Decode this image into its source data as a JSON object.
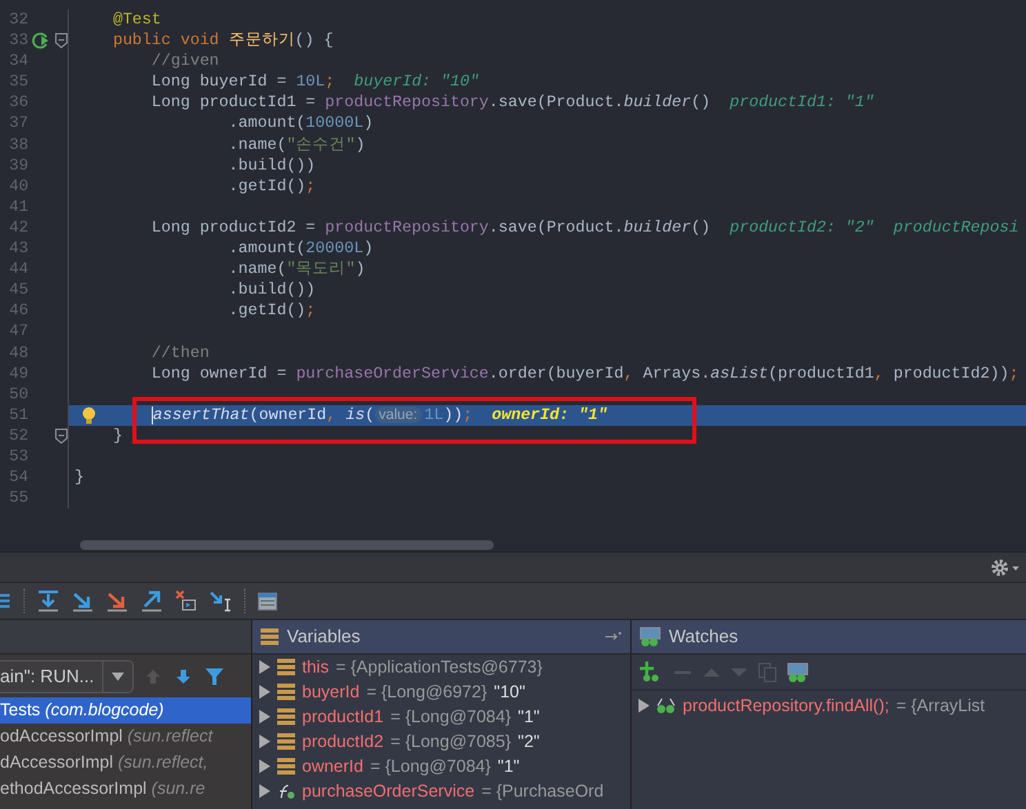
{
  "editor": {
    "lines": [
      {
        "number": "32",
        "current": false,
        "boxed": false,
        "segments": [
          {
            "kind": "annotation",
            "text": "    @Test"
          }
        ]
      },
      {
        "number": "33",
        "current": false,
        "boxed": false,
        "markers": [
          {
            "kind": "run"
          },
          {
            "kind": "fold"
          }
        ],
        "segments": [
          {
            "kind": "keyword",
            "text": "    public void "
          },
          {
            "kind": "method",
            "text": "주문하기"
          },
          {
            "kind": "plain",
            "text": "() {"
          }
        ]
      },
      {
        "number": "34",
        "current": false,
        "boxed": false,
        "segments": [
          {
            "kind": "comment",
            "text": "        //given"
          }
        ]
      },
      {
        "number": "35",
        "current": false,
        "boxed": false,
        "segments": [
          {
            "kind": "plain",
            "text": "        Long buyerId = "
          },
          {
            "kind": "number",
            "text": "10L"
          },
          {
            "kind": "punct",
            "text": ";"
          },
          {
            "kind": "hint",
            "text": "buyerId: \"10\""
          }
        ]
      },
      {
        "number": "36",
        "current": false,
        "boxed": false,
        "segments": [
          {
            "kind": "plain",
            "text": "        Long productId1 = "
          },
          {
            "kind": "field",
            "text": "productRepository"
          },
          {
            "kind": "plain",
            "text": ".save(Product."
          },
          {
            "kind": "static",
            "text": "builder"
          },
          {
            "kind": "plain",
            "text": "()"
          },
          {
            "kind": "hint",
            "text": "productId1: \"1\""
          }
        ]
      },
      {
        "number": "37",
        "current": false,
        "boxed": false,
        "segments": [
          {
            "kind": "plain",
            "text": "                .amount("
          },
          {
            "kind": "number",
            "text": "10000L"
          },
          {
            "kind": "plain",
            "text": ")"
          }
        ]
      },
      {
        "number": "38",
        "current": false,
        "boxed": false,
        "segments": [
          {
            "kind": "plain",
            "text": "                .name("
          },
          {
            "kind": "string",
            "text": "\"손수건\""
          },
          {
            "kind": "plain",
            "text": ")"
          }
        ]
      },
      {
        "number": "39",
        "current": false,
        "boxed": false,
        "segments": [
          {
            "kind": "plain",
            "text": "                .build())"
          }
        ]
      },
      {
        "number": "40",
        "current": false,
        "boxed": false,
        "segments": [
          {
            "kind": "plain",
            "text": "                .getId()"
          },
          {
            "kind": "punct",
            "text": ";"
          }
        ]
      },
      {
        "number": "41",
        "current": false,
        "boxed": false
      },
      {
        "number": "42",
        "current": false,
        "boxed": false,
        "segments": [
          {
            "kind": "plain",
            "text": "        Long productId2 = "
          },
          {
            "kind": "field",
            "text": "productRepository"
          },
          {
            "kind": "plain",
            "text": ".save(Product."
          },
          {
            "kind": "static",
            "text": "builder"
          },
          {
            "kind": "plain",
            "text": "()"
          },
          {
            "kind": "hint",
            "text": "productId2: \"2\""
          },
          {
            "kind": "hint",
            "text": "productReposi"
          }
        ]
      },
      {
        "number": "43",
        "current": false,
        "boxed": false,
        "segments": [
          {
            "kind": "plain",
            "text": "                .amount("
          },
          {
            "kind": "number",
            "text": "20000L"
          },
          {
            "kind": "plain",
            "text": ")"
          }
        ]
      },
      {
        "number": "44",
        "current": false,
        "boxed": false,
        "segments": [
          {
            "kind": "plain",
            "text": "                .name("
          },
          {
            "kind": "string",
            "text": "\"목도리\""
          },
          {
            "kind": "plain",
            "text": ")"
          }
        ]
      },
      {
        "number": "45",
        "current": false,
        "boxed": false,
        "segments": [
          {
            "kind": "plain",
            "text": "                .build())"
          }
        ]
      },
      {
        "number": "46",
        "current": false,
        "boxed": false,
        "segments": [
          {
            "kind": "plain",
            "text": "                .getId()"
          },
          {
            "kind": "punct",
            "text": ";"
          }
        ]
      },
      {
        "number": "47",
        "current": false,
        "boxed": false
      },
      {
        "number": "48",
        "current": false,
        "boxed": false,
        "segments": [
          {
            "kind": "comment",
            "text": "        //then"
          }
        ]
      },
      {
        "number": "49",
        "current": false,
        "boxed": false,
        "segments": [
          {
            "kind": "plain",
            "text": "        Long ownerId = "
          },
          {
            "kind": "field",
            "text": "purchaseOrderService"
          },
          {
            "kind": "plain",
            "text": ".order(buyerId"
          },
          {
            "kind": "punct",
            "text": ", "
          },
          {
            "kind": "plain",
            "text": "Arrays."
          },
          {
            "kind": "static",
            "text": "asList"
          },
          {
            "kind": "plain",
            "text": "(productId1"
          },
          {
            "kind": "punct",
            "text": ", "
          },
          {
            "kind": "plain",
            "text": "productId2))"
          },
          {
            "kind": "punct",
            "text": ";"
          }
        ]
      },
      {
        "number": "50",
        "current": false,
        "boxed": false
      },
      {
        "number": "51",
        "current": true,
        "boxed": true,
        "markers": [
          {
            "kind": "bulb"
          }
        ],
        "segments": [
          {
            "kind": "static",
            "text": "        assertThat"
          },
          {
            "kind": "plain",
            "text": "(ownerId"
          },
          {
            "kind": "punct",
            "text": ", "
          },
          {
            "kind": "static",
            "text": "is"
          },
          {
            "kind": "plain",
            "text": "("
          },
          {
            "kind": "param",
            "text": "value:"
          },
          {
            "kind": "number",
            "text": "1L"
          },
          {
            "kind": "plain",
            "text": "))"
          },
          {
            "kind": "punct",
            "text": ";"
          },
          {
            "kind": "value",
            "text": "ownerId: \"1\""
          }
        ]
      },
      {
        "number": "52",
        "current": false,
        "boxed": false,
        "markers": [
          {
            "kind": "fold"
          }
        ],
        "segments": [
          {
            "kind": "plain",
            "text": "    }"
          }
        ]
      },
      {
        "number": "53",
        "current": false,
        "boxed": false
      },
      {
        "number": "54",
        "current": false,
        "boxed": false,
        "segments": [
          {
            "kind": "plain",
            "text": "}"
          }
        ]
      },
      {
        "number": "55",
        "current": false,
        "boxed": false
      }
    ]
  },
  "debugger": {
    "frames": {
      "thread": "ain\": RUN...",
      "toolbar": [
        {
          "kind": "up",
          "disabled": true
        },
        {
          "kind": "down",
          "disabled": false
        },
        {
          "kind": "filter",
          "disabled": false
        }
      ],
      "items": [
        {
          "method": "Tests",
          "location": "(com.blogcode)",
          "selected": true
        },
        {
          "method": "odAccessorImpl",
          "location": "(sun.reflect",
          "selected": false
        },
        {
          "method": "dAccessorImpl",
          "location": "(sun.reflect,",
          "selected": false
        },
        {
          "method": "ethodAccessorImpl",
          "location": "(sun.re",
          "selected": false
        }
      ]
    },
    "variables": {
      "title": "Variables",
      "items": [
        {
          "kind": "object",
          "expanded": false,
          "name": "this",
          "value": "= {ApplicationTests@6773}"
        },
        {
          "kind": "object",
          "expanded": false,
          "name": "buyerId",
          "value": "= {Long@6972}",
          "display": "\"10\""
        },
        {
          "kind": "object",
          "expanded": false,
          "name": "productId1",
          "value": "= {Long@7084}",
          "display": "\"1\""
        },
        {
          "kind": "object",
          "expanded": false,
          "name": "productId2",
          "value": "= {Long@7085}",
          "display": "\"2\""
        },
        {
          "kind": "object",
          "expanded": false,
          "name": "ownerId",
          "value": "= {Long@7084}",
          "display": "\"1\""
        },
        {
          "kind": "field",
          "expanded": false,
          "name": "purchaseOrderService",
          "value": "= {PurchaseOrd"
        }
      ]
    },
    "watches": {
      "title": "Watches",
      "toolbar": [
        {
          "kind": "add",
          "disabled": false
        },
        {
          "kind": "remove",
          "disabled": true
        },
        {
          "kind": "up",
          "disabled": true
        },
        {
          "kind": "down",
          "disabled": true
        },
        {
          "kind": "copy",
          "disabled": true
        },
        {
          "kind": "watch",
          "disabled": false
        }
      ],
      "items": [
        {
          "expanded": false,
          "expression": "productRepository.findAll();",
          "value": "= {ArrayList"
        }
      ]
    }
  }
}
